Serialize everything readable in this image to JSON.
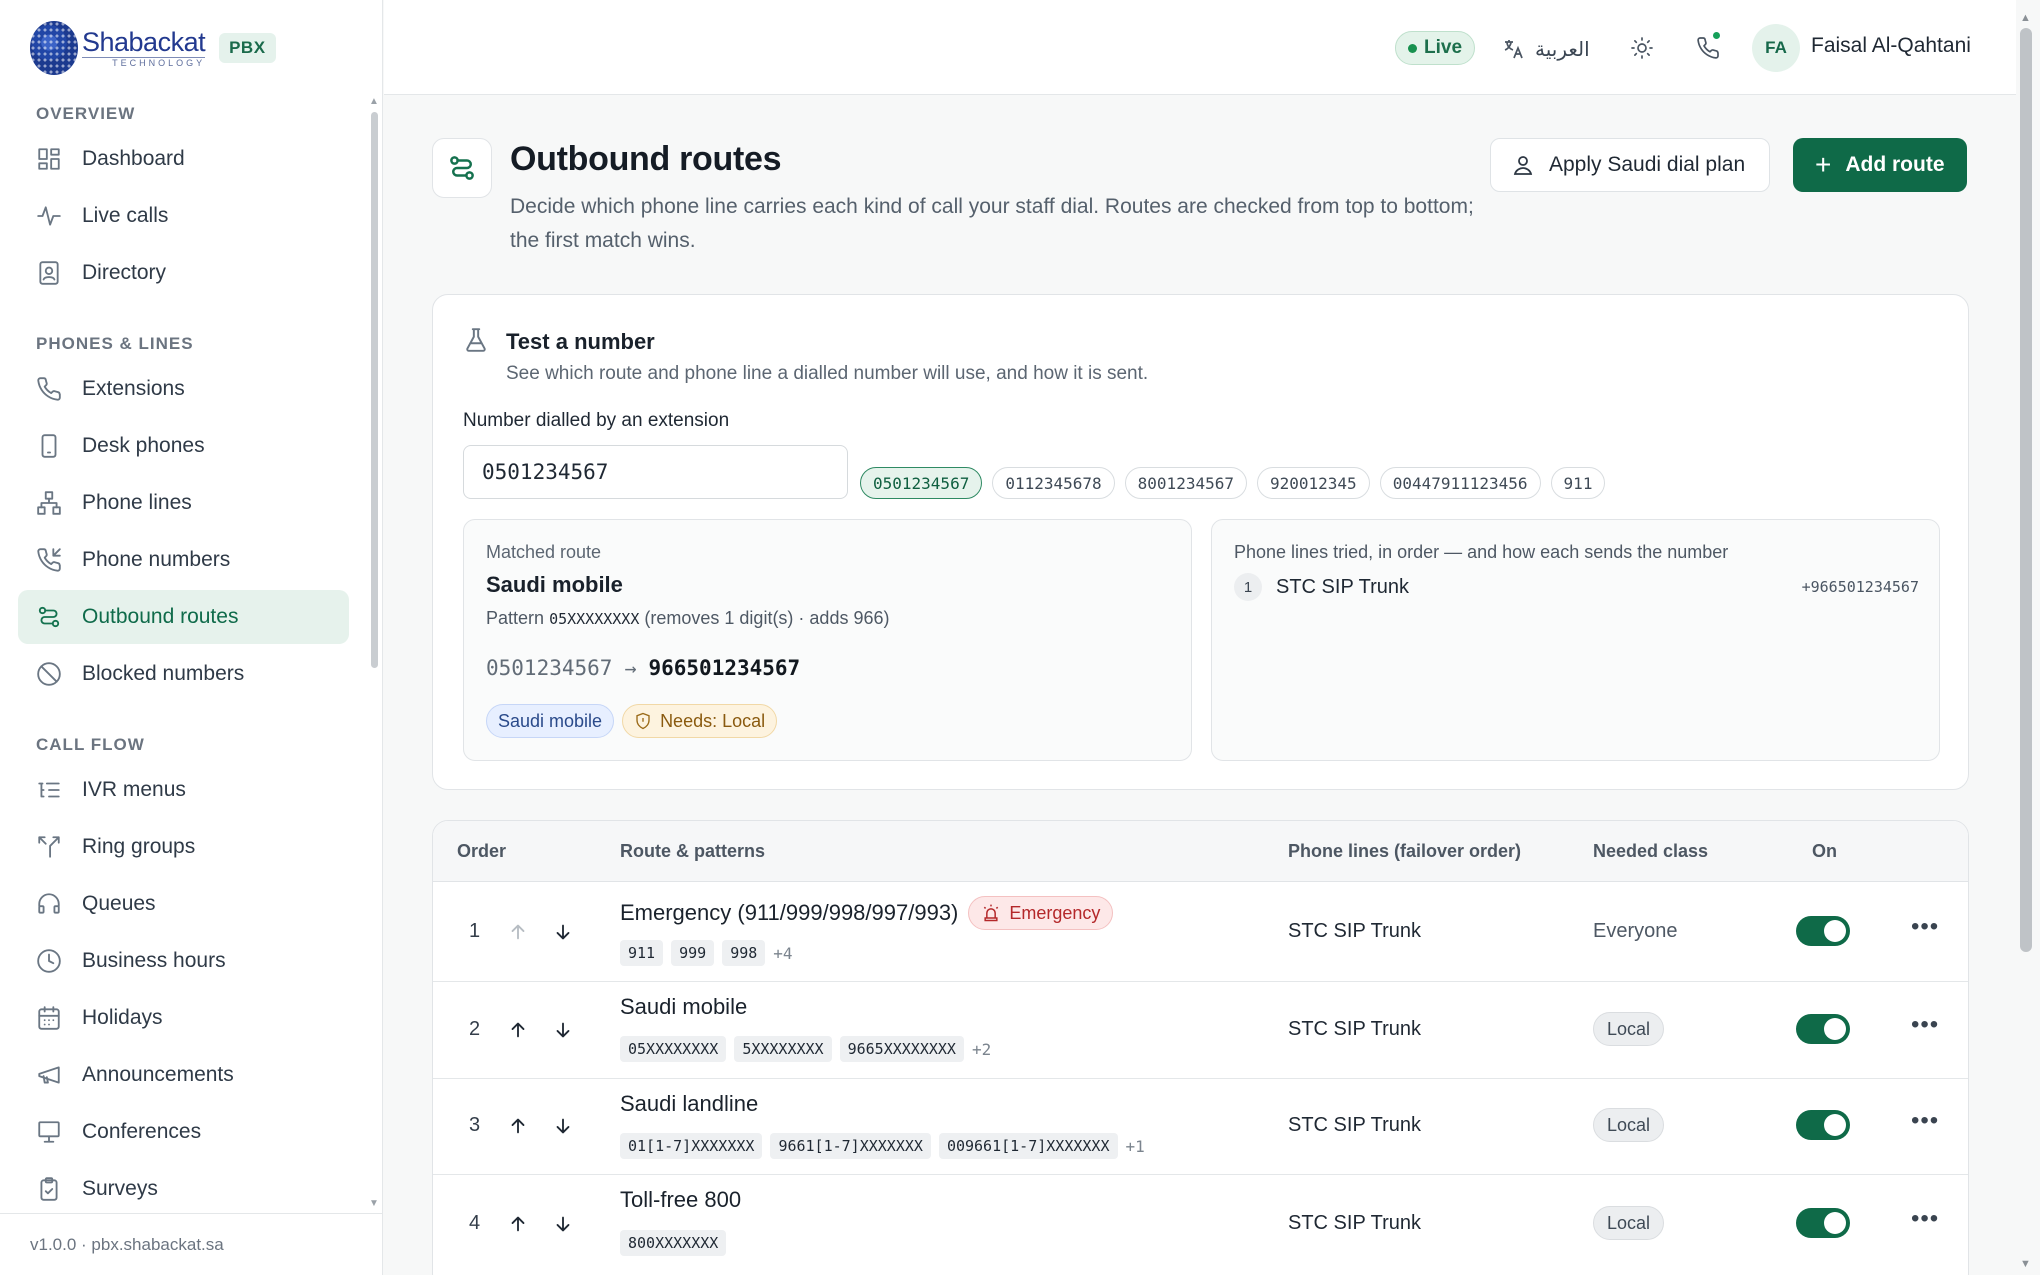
{
  "brand": {
    "name": "Shabackat",
    "sub": "TECHNOLOGY",
    "badge": "PBX"
  },
  "sidebar": {
    "sections": [
      {
        "title": "OVERVIEW"
      },
      {
        "title": "PHONES & LINES"
      },
      {
        "title": "CALL FLOW"
      }
    ],
    "items": [
      {
        "label": "Dashboard",
        "icon": "dashboard-icon"
      },
      {
        "label": "Live calls",
        "icon": "activity-icon"
      },
      {
        "label": "Directory",
        "icon": "contact-book-icon"
      },
      {
        "label": "Extensions",
        "icon": "phone-icon"
      },
      {
        "label": "Desk phones",
        "icon": "device-icon"
      },
      {
        "label": "Phone lines",
        "icon": "network-icon"
      },
      {
        "label": "Phone numbers",
        "icon": "phone-incoming-icon"
      },
      {
        "label": "Outbound routes",
        "icon": "route-icon",
        "active": true
      },
      {
        "label": "Blocked numbers",
        "icon": "blocked-icon"
      },
      {
        "label": "IVR menus",
        "icon": "list-tree-icon"
      },
      {
        "label": "Ring groups",
        "icon": "split-icon"
      },
      {
        "label": "Queues",
        "icon": "headset-icon"
      },
      {
        "label": "Business hours",
        "icon": "clock-icon"
      },
      {
        "label": "Holidays",
        "icon": "calendar-icon"
      },
      {
        "label": "Announcements",
        "icon": "megaphone-icon"
      },
      {
        "label": "Conferences",
        "icon": "presentation-icon"
      },
      {
        "label": "Surveys",
        "icon": "clipboard-check-icon"
      }
    ],
    "footer": "v1.0.0 · pbx.shabackat.sa"
  },
  "topbar": {
    "status": "Live",
    "language": "العربية",
    "user_initials": "FA",
    "user_name": "Faisal Al-Qahtani"
  },
  "page": {
    "title": "Outbound routes",
    "description": "Decide which phone line carries each kind of call your staff dial. Routes are checked from top to bottom; the first match wins.",
    "apply_button": "Apply Saudi dial plan",
    "add_button": "Add route"
  },
  "tester": {
    "title": "Test a number",
    "subtitle": "See which route and phone line a dialled number will use, and how it is sent.",
    "field_label": "Number dialled by an extension",
    "value": "0501234567",
    "samples": [
      "0501234567",
      "0112345678",
      "8001234567",
      "920012345",
      "00447911123456",
      "911"
    ],
    "matched_label": "Matched route",
    "matched_route": "Saudi mobile",
    "pattern_prefix": "Pattern",
    "pattern": "05XXXXXXXX",
    "pattern_suffix": "(removes 1 digit(s) · adds 966)",
    "from_number": "0501234567",
    "to_number": "966501234567",
    "tag_category": "Saudi mobile",
    "tag_needs": "Needs: Local",
    "lines_label": "Phone lines tried, in order — and how each sends the number",
    "lines": [
      {
        "index": "1",
        "name": "STC SIP Trunk",
        "sent_as": "+966501234567"
      }
    ]
  },
  "table": {
    "headers": {
      "order": "Order",
      "route": "Route & patterns",
      "lines": "Phone lines (failover order)",
      "class": "Needed class",
      "on": "On"
    },
    "rows": [
      {
        "order": "1",
        "name": "Emergency (911/999/998/997/993)",
        "badge": "Emergency",
        "patterns": [
          "911",
          "999",
          "998"
        ],
        "more": "+4",
        "line": "STC SIP Trunk",
        "class": "Everyone",
        "on": true
      },
      {
        "order": "2",
        "name": "Saudi mobile",
        "patterns": [
          "05XXXXXXXX",
          "5XXXXXXXX",
          "9665XXXXXXXX"
        ],
        "more": "+2",
        "line": "STC SIP Trunk",
        "class": "Local",
        "on": true
      },
      {
        "order": "3",
        "name": "Saudi landline",
        "patterns": [
          "01[1-7]XXXXXXX",
          "9661[1-7]XXXXXXX",
          "009661[1-7]XXXXXXX"
        ],
        "more": "+1",
        "line": "STC SIP Trunk",
        "class": "Local",
        "on": true
      },
      {
        "order": "4",
        "name": "Toll-free 800",
        "patterns": [
          "800XXXXXXX"
        ],
        "more": "",
        "line": "STC SIP Trunk",
        "class": "Local",
        "on": true
      }
    ]
  },
  "colors": {
    "accent": "#0f6a48",
    "accent_soft": "#e6f2ec",
    "danger": "#b4282a",
    "warning": "#8a5a0f"
  }
}
